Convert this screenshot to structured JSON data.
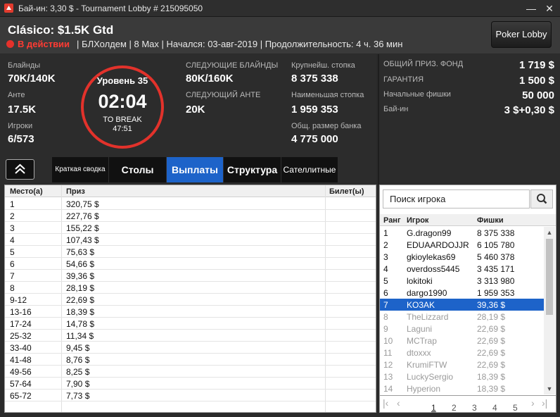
{
  "window": {
    "title": "Бай-ин: 3,30 $ - Tournament Lobby # 215095050",
    "minimize_label": "—",
    "close_label": "✕"
  },
  "header": {
    "tourney_name": "Clásico: $1.5K Gtd",
    "status": "В действии",
    "details": "| БЛХолдем | 8 Max | Начался: 03-авг-2019 | Продолжительность: 4 ч. 36 мин",
    "lobby_button": "Poker Lobby"
  },
  "info": {
    "blinds_label": "Блайнды",
    "blinds_value": "70K/140K",
    "ante_label": "Анте",
    "ante_value": "17.5K",
    "players_label": "Игроки",
    "players_value": "6/573",
    "timer": {
      "level": "Уровень 35",
      "clock": "02:04",
      "break_label": "TO BREAK",
      "break_time": "47:51"
    },
    "next_blinds_label": "СЛЕДУЮЩИЕ БЛАЙНДЫ",
    "next_blinds_value": "80K/160K",
    "next_ante_label": "СЛЕДУЮЩИЙ АНТЕ",
    "next_ante_value": "20K",
    "largest_stack_label": "Крупнейш. стопка",
    "largest_stack_value": "8 375 338",
    "smallest_stack_label": "Наименьшая стопка",
    "smallest_stack_value": "1 959 353",
    "total_bank_label": "Общ. размер банка",
    "total_bank_value": "4 775 000"
  },
  "prize_info": {
    "pool_label": "ОБЩИЙ ПРИЗ. ФОНД",
    "pool_value": "1 719 $",
    "guarantee_label": "ГАРАНТИЯ",
    "guarantee_value": "1 500 $",
    "chips_label": "Начальные фишки",
    "chips_value": "50 000",
    "buyin_label": "Бай-ин",
    "buyin_value": "3 $+0,30 $"
  },
  "tabs": [
    "Краткая сводка",
    "Столы",
    "Выплаты",
    "Структура",
    "Сателлитные"
  ],
  "active_tab": "Выплаты",
  "payouts": {
    "headers": {
      "place": "Место(а)",
      "prize": "Приз",
      "ticket": "Билет(ы)"
    },
    "rows": [
      {
        "place": "1",
        "prize": "320,75 $"
      },
      {
        "place": "2",
        "prize": "227,76 $"
      },
      {
        "place": "3",
        "prize": "155,22 $"
      },
      {
        "place": "4",
        "prize": "107,43 $"
      },
      {
        "place": "5",
        "prize": "75,63 $"
      },
      {
        "place": "6",
        "prize": "54,66 $"
      },
      {
        "place": "7",
        "prize": "39,36 $"
      },
      {
        "place": "8",
        "prize": "28,19 $"
      },
      {
        "place": "9-12",
        "prize": "22,69 $"
      },
      {
        "place": "13-16",
        "prize": "18,39 $"
      },
      {
        "place": "17-24",
        "prize": "14,78 $"
      },
      {
        "place": "25-32",
        "prize": "11,34 $"
      },
      {
        "place": "33-40",
        "prize": "9,45 $"
      },
      {
        "place": "41-48",
        "prize": "8,76 $"
      },
      {
        "place": "49-56",
        "prize": "8,25 $"
      },
      {
        "place": "57-64",
        "prize": "7,90 $"
      },
      {
        "place": "65-72",
        "prize": "7,73 $"
      }
    ]
  },
  "search": {
    "placeholder": "Поиск игрока"
  },
  "players": {
    "headers": {
      "rank": "Ранг",
      "player": "Игрок",
      "chips": "Фишки"
    },
    "rows": [
      {
        "rank": "1",
        "name": "G.dragon99",
        "chips": "8 375 338",
        "state": "active"
      },
      {
        "rank": "2",
        "name": "EDUAARDOJJR",
        "chips": "6 105 780",
        "state": "active"
      },
      {
        "rank": "3",
        "name": "gkioylekas69",
        "chips": "5 460 378",
        "state": "active"
      },
      {
        "rank": "4",
        "name": "overdoss5445",
        "chips": "3 435 171",
        "state": "active"
      },
      {
        "rank": "5",
        "name": "lokitoki",
        "chips": "3 313 980",
        "state": "active"
      },
      {
        "rank": "6",
        "name": "dargo1990",
        "chips": "1 959 353",
        "state": "active"
      },
      {
        "rank": "7",
        "name": "KO3AK",
        "chips": "39,36 $",
        "state": "selected"
      },
      {
        "rank": "8",
        "name": "TheLizzard",
        "chips": "28,19 $",
        "state": "out"
      },
      {
        "rank": "9",
        "name": "Laguni",
        "chips": "22,69 $",
        "state": "out"
      },
      {
        "rank": "10",
        "name": "MCTrap",
        "chips": "22,69 $",
        "state": "out"
      },
      {
        "rank": "11",
        "name": "dtoxxx",
        "chips": "22,69 $",
        "state": "out"
      },
      {
        "rank": "12",
        "name": "KrumiFTW",
        "chips": "22,69 $",
        "state": "out"
      },
      {
        "rank": "13",
        "name": "LuckySergio",
        "chips": "18,39 $",
        "state": "out"
      },
      {
        "rank": "14",
        "name": "Hyperion",
        "chips": "18,39 $",
        "state": "out"
      }
    ]
  },
  "pager": {
    "first": "|‹",
    "prev": "‹",
    "pages": [
      "1",
      "2",
      "3",
      "4",
      "5"
    ],
    "current": "1",
    "next": "›",
    "last": "›|"
  },
  "colors": {
    "accent": "#1d63c9",
    "status_red": "#ff3b33",
    "timer_ring": "#e2322b"
  }
}
